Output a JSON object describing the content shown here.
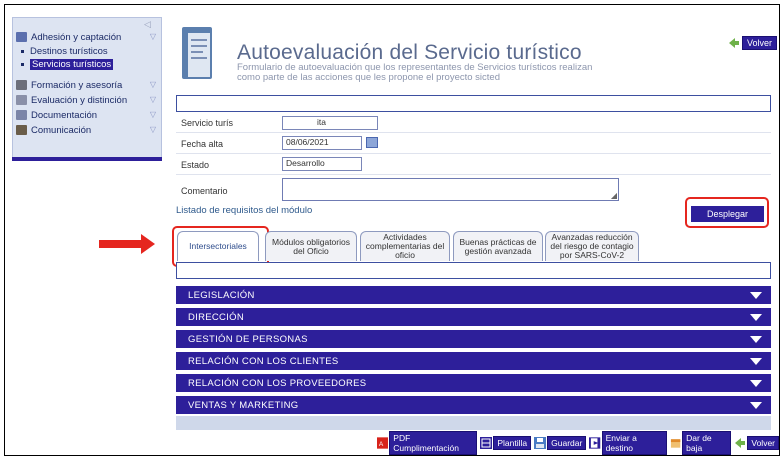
{
  "sidebar": {
    "items": [
      {
        "label": "Adhesión y captación",
        "icon": "folder-icon",
        "color": "#5b6fae"
      },
      {
        "label": "Formación y asesoría",
        "icon": "book-icon",
        "color": "#6d6f7a"
      },
      {
        "label": "Evaluación y distinción",
        "icon": "pencil-icon",
        "color": "#8a90a8"
      },
      {
        "label": "Documentación",
        "icon": "document-icon",
        "color": "#7b85a8"
      },
      {
        "label": "Comunicación",
        "icon": "users-icon",
        "color": "#6a5d4a"
      }
    ],
    "subitems": [
      {
        "label": "Destinos turísticos",
        "active": false
      },
      {
        "label": "Servicios turísticos",
        "active": true
      }
    ]
  },
  "header": {
    "title": "Autoevaluación del Servicio turístico",
    "subtitle": "Formulario de autoevaluación que los representantes de Servicios turísticos realizan como parte de las acciones que les propone el proyecto sicted",
    "volver_label": "Volver"
  },
  "form": {
    "servicio_label": "Servicio turís",
    "servicio_value": "ita",
    "fecha_label": "Fecha alta",
    "fecha_value": "08/06/2021",
    "estado_label": "Estado",
    "estado_value": "Desarrollo",
    "comentario_label": "Comentario",
    "comentario_value": ""
  },
  "listado_label": "Listado de requisitos del módulo",
  "desplegar_label": "Desplegar",
  "tabs": [
    {
      "label": "Intersectoriales"
    },
    {
      "label": "Módulos obligatorios del Oficio"
    },
    {
      "label": "Actividades complementarias del oficio"
    },
    {
      "label": "Buenas prácticas de gestión avanzada"
    },
    {
      "label": "Avanzadas reducción del riesgo de contagio por SARS-CoV-2"
    }
  ],
  "sections": [
    {
      "label": "LEGISLACIÓN"
    },
    {
      "label": "DIRECCIÓN"
    },
    {
      "label": "GESTIÓN DE PERSONAS"
    },
    {
      "label": "RELACIÓN CON LOS CLIENTES"
    },
    {
      "label": "RELACIÓN CON LOS PROVEEDORES"
    },
    {
      "label": "VENTAS Y MARKETING"
    }
  ],
  "actions": [
    {
      "label": "PDF Cumplimentación",
      "icon": "pdf-icon"
    },
    {
      "label": "Plantilla",
      "icon": "template-icon"
    },
    {
      "label": "Guardar",
      "icon": "save-icon"
    },
    {
      "label": "Enviar a destino",
      "icon": "send-icon"
    },
    {
      "label": "Dar de baja",
      "icon": "unsubscribe-icon"
    },
    {
      "label": "Volver",
      "icon": "back-icon"
    }
  ],
  "colors": {
    "accent": "#2d1f9a",
    "highlight": "#e5261f"
  }
}
